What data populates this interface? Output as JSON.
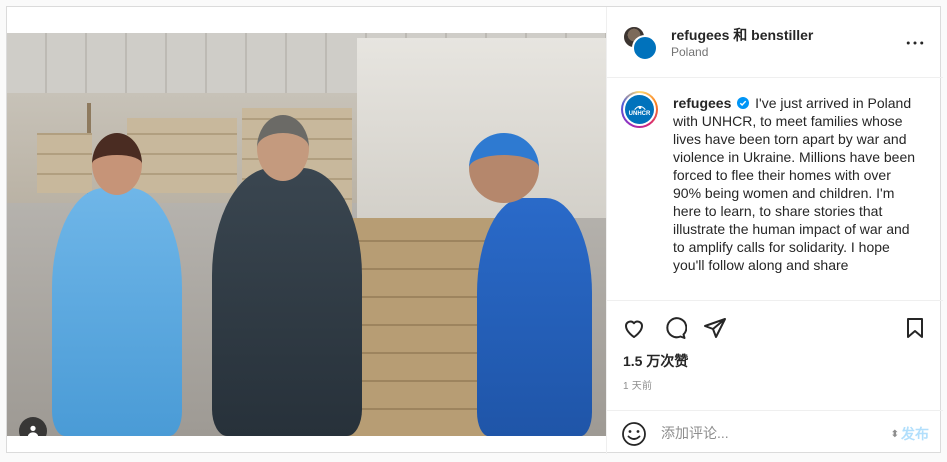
{
  "header": {
    "names": "refugees 和 benstiller",
    "location": "Poland"
  },
  "caption": {
    "username": "refugees",
    "text": "I've just arrived in Poland with UNHCR, to meet families whose lives have been torn apart by war and violence in Ukraine. Millions have been forced to flee their homes with over 90% being women and children. I'm here to learn, to share stories that illustrate the human impact of war and to amplify calls for solidarity. I hope you'll follow along and share"
  },
  "logo_text": "UNHCR",
  "stats": {
    "likes": "1.5 万次赞",
    "time": "1 天前"
  },
  "comment": {
    "placeholder": "添加评论...",
    "post_label": "发布"
  },
  "icons": {
    "more": "more-horizontal-icon",
    "like": "heart-icon",
    "comment": "comment-bubble-icon",
    "share": "paper-plane-icon",
    "save": "bookmark-icon",
    "emoji": "emoji-smile-icon",
    "tag": "user-tag-icon",
    "verified": "verified-badge-icon"
  },
  "colors": {
    "verified": "#0095f6",
    "unhcr_blue": "#0072bc",
    "post_button_disabled": "#b2dffc"
  }
}
